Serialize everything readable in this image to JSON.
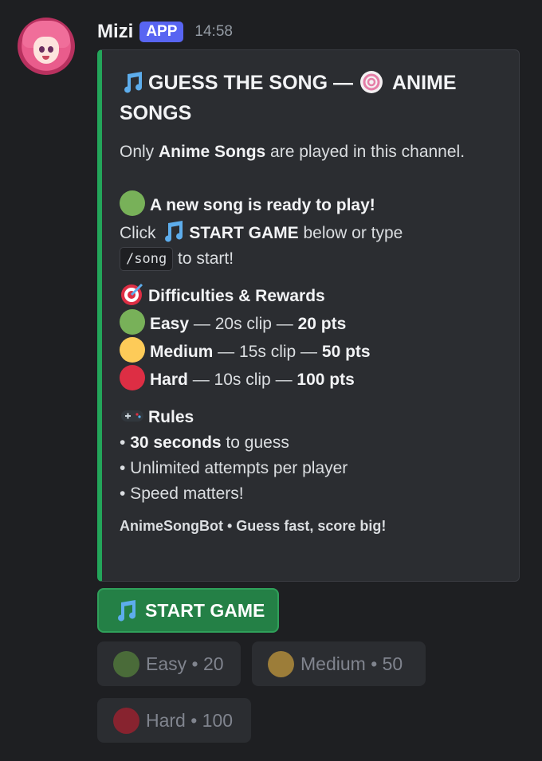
{
  "author": {
    "name": "Mizi",
    "badge": "APP",
    "time": "14:58"
  },
  "embed": {
    "accent_color": "#23a55a",
    "title": "GUESS THE SONG — ",
    "title_tail": " ANIME SONGS",
    "intro_prefix": "Only ",
    "intro_bold": "Anime Songs",
    "intro_suffix": " are played in this channel.",
    "ready_line": "A new song is ready to play!",
    "click_prefix": "Click ",
    "click_bold": "START GAME",
    "click_suffix": " below or type",
    "command": "/song",
    "to_start": " to start!",
    "difficulties_heading": "Difficulties & Rewards",
    "difficulties": [
      {
        "name": "Easy",
        "clip": " — 20s clip — ",
        "points": "20 pts",
        "color": "#78b159"
      },
      {
        "name": "Medium",
        "clip": " — 15s clip — ",
        "points": "50 pts",
        "color": "#fdcb58"
      },
      {
        "name": "Hard",
        "clip": " — 10s clip — ",
        "points": "100 pts",
        "color": "#dd2e44"
      }
    ],
    "rules_heading": "Rules",
    "rule1_bold": "30 seconds",
    "rule1_rest": " to guess",
    "rule2": "• Unlimited attempts per player",
    "rule3": "• Speed matters!",
    "bullet": "• ",
    "footer": "AnimeSongBot • Guess fast, score big!"
  },
  "buttons": {
    "start": "START GAME",
    "easy": "Easy • 20",
    "medium": "Medium • 50",
    "hard": "Hard • 100"
  }
}
